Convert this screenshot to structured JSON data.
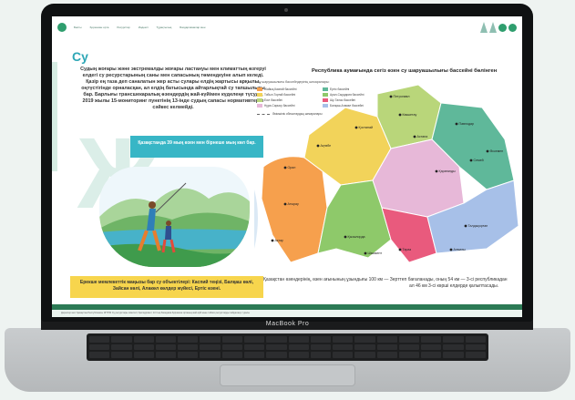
{
  "device": {
    "brand_label": "MacBook Pro"
  },
  "nav": {
    "items": [
      "Басты",
      "Қоршаған орта",
      "Ресурстар",
      "Индексі",
      "Тұрақтылық",
      "Бағдарламалар мен"
    ]
  },
  "page": {
    "title": "Су",
    "background_letter": "Ж",
    "intro_text": "Судың жоғары және экстремалды жоғары ластануы мен климаттың өзгеруі елдегі су ресурстарының саны мен сапасының төмендеуіне алып келеді. Қазір ең таза деп саналатын жер асты сулары елдің жартысы арқылы, оңтүстігінде орналасқан, ал елдің батысында айтарлықтай су тапшылығы бар. Барлығы трансшекаралық өзендердің жай-күйімен күделеңе түсуде, 2019 жылы 15-мониторинг пунктінің 13-інде судың сапасы нормативтерге сәйкес келмейді.",
    "highlight_text": "Қазақстанда 39 мың өзен мен бірнеше мың көл бар.",
    "important_objects_text": "Ерекше мемлекеттік маңызы бар су объектілері: Каспий теңізі, Балқаш көлі, Зайсан көлі, Алакөл көлдер жүйесі, Ертіс өзені."
  },
  "map": {
    "title": "Республика аумағында сегіз өзен су шаруашылығы бассейні бөлінген",
    "legend_title": "Су шаруашылығы бассейндерінің шекаралары:",
    "legend": [
      {
        "label": "Жайық-Каспий бассейні",
        "color": "#f6a04d"
      },
      {
        "label": "Ертіс бассейні",
        "color": "#5fb89a"
      },
      {
        "label": "Тобыл-Торғай бассейні",
        "color": "#f2d35a"
      },
      {
        "label": "Арал-Сырдария бассейні",
        "color": "#8ec96a"
      },
      {
        "label": "Есіл бассейні",
        "color": "#b9d67a"
      },
      {
        "label": "Шу-Талас бассейні",
        "color": "#e95a7d"
      },
      {
        "label": "Нұра-Сарысу бассейні",
        "color": "#e7b8d8"
      },
      {
        "label": "Балқаш-Алакөл бассейні",
        "color": "#a7c0e8"
      }
    ],
    "border_label": "Әкімшілік облыстардың шекаралары",
    "cities": [
      "Петропавл",
      "Қостанай",
      "Павлодар",
      "Көкшетау",
      "Астана",
      "Өскемен",
      "Орал",
      "Ақтөбе",
      "Қарағанды",
      "Семей",
      "Атырау",
      "Ақтау",
      "Қызылорда",
      "Талдықорған",
      "Тараз",
      "Алматы",
      "Шымкент"
    ],
    "caption_line1": "Қазақстан өзендерінің, өзен ағынының ұзындығы 100 км — Зерттеп бағаланады, оның 54 км — 3-сі республикадан",
    "caption_line2": "ал 46 км 3-сі көрші елдерде қалыптасады."
  },
  "footer": {
    "text": "Деректер көзі: Қазақстан Республикасы ЭГТРМ Су ресурстары комитеті; Қазгидромет; Ұлттық баяндама Қоршаған ортаның жай-күйі және табиғи ресурстарды пайдалану туралы"
  }
}
